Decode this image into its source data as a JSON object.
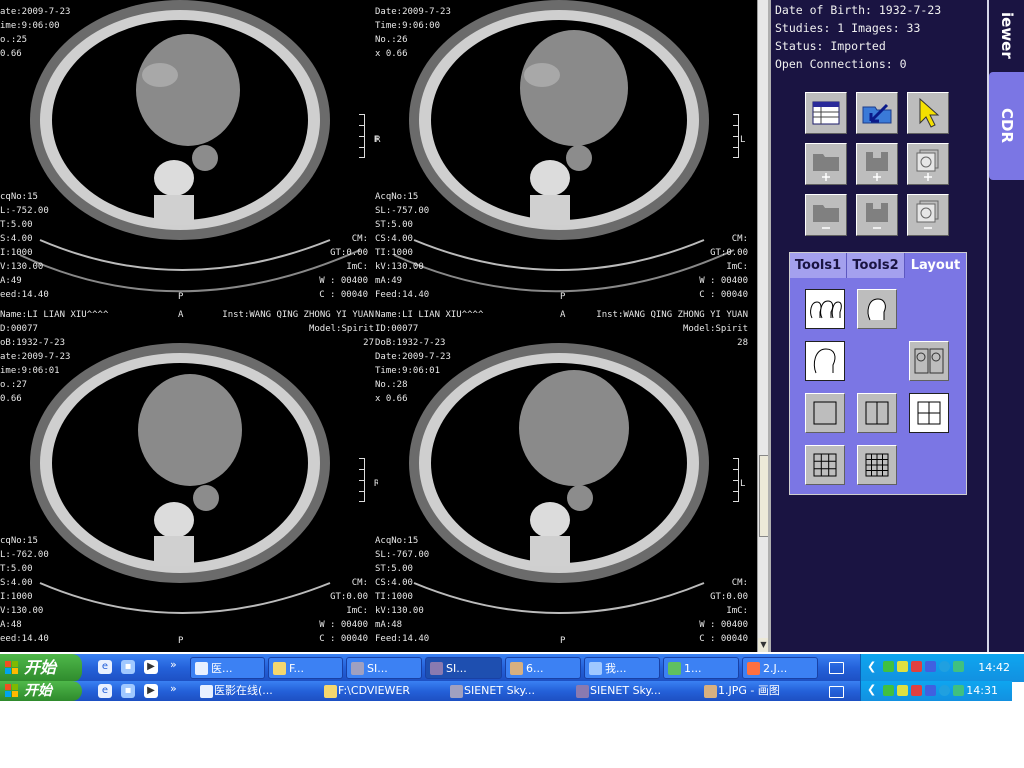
{
  "viewer": {
    "images": [
      {
        "top_left": [
          "ate:2009-7-23",
          "ime:9:06:00",
          "o.:25",
          "0.66"
        ],
        "bottom_left": [
          "cqNo:15",
          "L:-752.00",
          "T:5.00",
          "S:4.00",
          "I:1000",
          "V:130.00",
          "A:49",
          "eed:14.40"
        ],
        "bottom_right": [
          "CM:",
          "GT:0.00",
          "ImC:",
          "W : 00400",
          "C : 00040"
        ],
        "top_right": [
          "",
          "",
          "",
          "",
          ""
        ],
        "orientation_right": "R",
        "orientation_bottom": "P",
        "orientation_top": "",
        "scale_label": "L"
      },
      {
        "top_left": [
          "Date:2009-7-23",
          "Time:9:06:00",
          "No.:26",
          "x 0.66"
        ],
        "bottom_left": [
          "AcqNo:15",
          "SL:-757.00",
          "ST:5.00",
          "CS:4.00",
          "TI:1000",
          "kV:130.00",
          "mA:49",
          "Feed:14.40"
        ],
        "bottom_right": [
          "CM:",
          "GT:0.00",
          "ImC:",
          "W : 00400",
          "C : 00040"
        ],
        "top_right": [],
        "orientation_right": "R",
        "orientation_bottom": "P",
        "orientation_top": "",
        "scale_label": "L"
      },
      {
        "top_left": [
          "Name:LI LIAN XIU^^^^",
          "D:00077",
          "oB:1932-7-23",
          "ate:2009-7-23",
          "ime:9:06:01",
          "o.:27",
          "0.66"
        ],
        "bottom_left": [
          "cqNo:15",
          "L:-762.00",
          "T:5.00",
          "S:4.00",
          "I:1000",
          "V:130.00",
          "A:48",
          "eed:14.40"
        ],
        "bottom_right": [
          "CM:",
          "GT:0.00",
          "ImC:",
          "W : 00400",
          "C : 00040"
        ],
        "top_right": [
          "Inst:WANG QING ZHONG YI YUAN",
          "Model:Spirit",
          "27"
        ],
        "orientation_right": "R",
        "orientation_bottom": "P",
        "orientation_top": "A",
        "scale_label": "L"
      },
      {
        "top_left": [
          "Name:LI LIAN XIU^^^^",
          "ID:00077",
          "DoB:1932-7-23",
          "Date:2009-7-23",
          "Time:9:06:01",
          "No.:28",
          "x 0.66"
        ],
        "bottom_left": [
          "AcqNo:15",
          "SL:-767.00",
          "ST:5.00",
          "CS:4.00",
          "TI:1000",
          "kV:130.00",
          "mA:48",
          "Feed:14.40"
        ],
        "bottom_right": [
          "CM:",
          "GT:0.00",
          "ImC:",
          "W : 00400",
          "C : 00040"
        ],
        "top_right": [
          "Inst:WANG QING ZHONG YI YUAN",
          "Model:Spirit",
          "28"
        ],
        "orientation_right": "",
        "orientation_bottom": "P",
        "orientation_top": "A",
        "scale_label": "L"
      }
    ],
    "top_partial_right": [
      "26",
      "25"
    ]
  },
  "info": {
    "dob": "Date of Birth: 1932-7-23",
    "studies": "Studies: 1 Images: 33",
    "status": "Status: Imported",
    "connections": "Open Connections: 0"
  },
  "side_tabs": {
    "viewer": "iewer",
    "cdr": "CDR"
  },
  "panel": {
    "tabs": [
      "Tools1",
      "Tools2",
      "Layout"
    ],
    "active_tab": "Layout"
  },
  "taskbar_top": {
    "start": "开始",
    "tasks": [
      "医...",
      "F...",
      "SI...",
      "SI...",
      "6...",
      "我...",
      "1...",
      "2.J..."
    ],
    "clock": "14:42"
  },
  "taskbar_bottom": {
    "start": "开始",
    "tasks": [
      "医影在线(...",
      "F:\\CDVIEWER",
      "SIENET Sky...",
      "SIENET Sky...",
      "1.JPG - 画图"
    ],
    "clock": "14:31"
  },
  "colors": {
    "side_bg": "#1a1442",
    "panel_bg": "#7b76e4",
    "taskbar": "#2461d9",
    "tray": "#0ea6f0",
    "start": "#3a9a36"
  }
}
